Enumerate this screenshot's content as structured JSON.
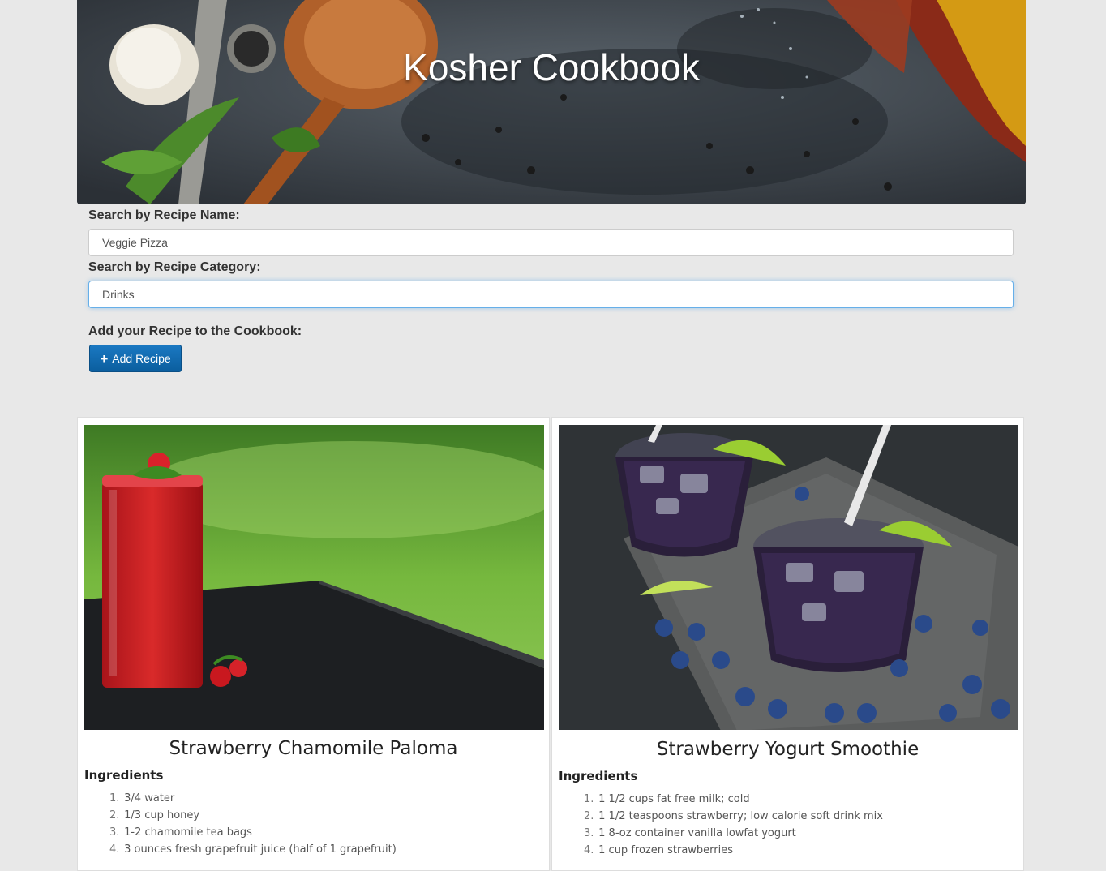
{
  "header": {
    "title": "Kosher Cookbook"
  },
  "search": {
    "name_label": "Search by Recipe Name:",
    "name_value": "Veggie Pizza",
    "category_label": "Search by Recipe Category:",
    "category_value": "Drinks"
  },
  "add": {
    "label": "Add your Recipe to the Cookbook:",
    "button": "Add Recipe"
  },
  "recipes": [
    {
      "title": "Strawberry Chamomile Paloma",
      "ingredients_label": "Ingredients",
      "ingredients": [
        "3/4 water",
        "1/3 cup honey",
        "1-2 chamomile tea bags",
        "3 ounces fresh grapefruit juice (half of 1 grapefruit)"
      ]
    },
    {
      "title": "Strawberry Yogurt Smoothie",
      "ingredients_label": "Ingredients",
      "ingredients": [
        "1 1/2 cups fat free milk; cold",
        "1 1/2 teaspoons strawberry; low calorie soft drink mix",
        "1 8-oz container vanilla lowfat yogurt",
        "1 cup frozen strawberries"
      ]
    }
  ]
}
